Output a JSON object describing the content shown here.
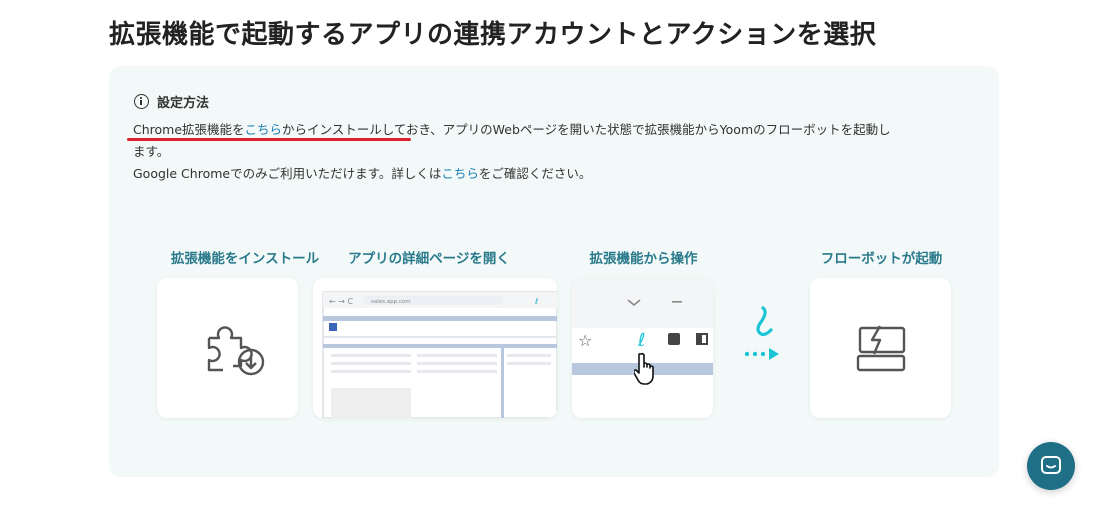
{
  "page": {
    "title": "拡張機能で起動するアプリの連携アカウントとアクションを選択"
  },
  "settings": {
    "heading": "設定方法",
    "line1_part1": "Chrome拡張機能を",
    "line1_link": "こちら",
    "line1_part2": "からインストールしておき、アプリのWebページを開いた状態で拡張機能からYoomのフローボットを起動し",
    "line1_part3": "ます。",
    "line2_part1": "Google Chromeでのみご利用いただけます。詳しくは",
    "line2_link": "こちら",
    "line2_part2": "をご確認ください。"
  },
  "steps": [
    {
      "label": "拡張機能をインストール"
    },
    {
      "label": "アプリの詳細ページを開く"
    },
    {
      "label": "拡張機能から操作"
    },
    {
      "label": "フローボットが起動"
    }
  ],
  "browser_mock": {
    "address": "sales.app.com"
  },
  "icons": {
    "info": "info-circle-icon",
    "puzzle": "puzzle-download-icon",
    "star": "star-icon",
    "extensions": "puzzle-icon",
    "sidepanel": "side-panel-icon",
    "cursor": "hand-cursor-icon",
    "yoom": "yoom-logo-icon",
    "flowbot": "flowbot-launch-icon",
    "chat": "chat-icon"
  },
  "colors": {
    "accent_teal": "#2a7a8c",
    "link_blue": "#1c7fb5",
    "underline_red": "#e0202a",
    "panel_bg": "#f2f9f8",
    "yoom_cyan": "#1bc5d6",
    "chat_button": "#1f6f86"
  }
}
